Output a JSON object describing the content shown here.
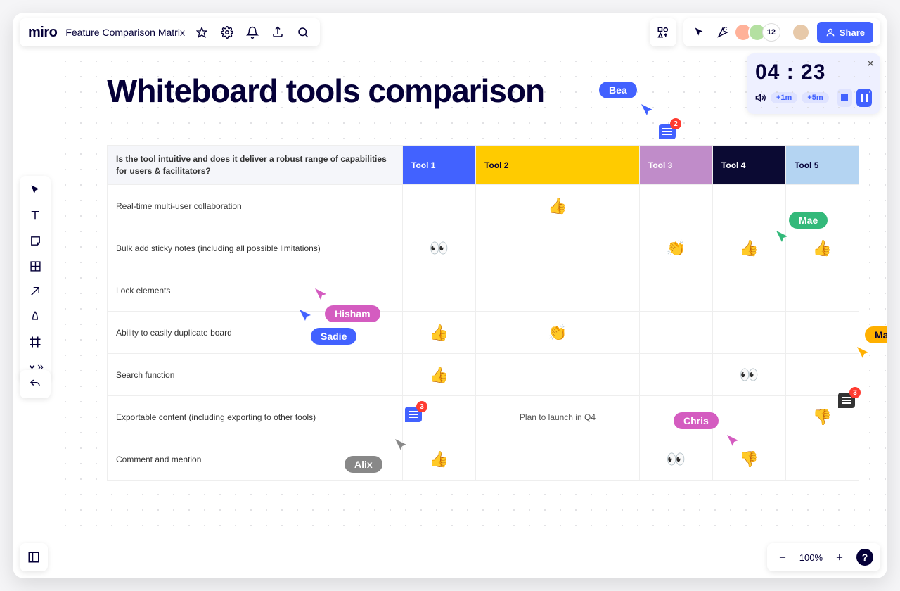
{
  "app": {
    "logo": "miro",
    "board_title": "Feature Comparison Matrix"
  },
  "collaborators": {
    "count_extra": "12"
  },
  "share_label": "Share",
  "timer": {
    "time": "04 : 23",
    "add1": "+1m",
    "add5": "+5m"
  },
  "canvas": {
    "title": "Whiteboard tools comparison",
    "question": "Is the tool intuitive and does it deliver a robust range of capabilities for users & facilitators?",
    "tools": [
      "Tool 1",
      "Tool 2",
      "Tool 3",
      "Tool 4",
      "Tool 5"
    ],
    "rows": [
      {
        "label": "Real-time multi-user collaboration",
        "cells": [
          "",
          "👍",
          "",
          "",
          ""
        ]
      },
      {
        "label": "Bulk add sticky notes (including all possible limitations)",
        "cells": [
          "👀",
          "",
          "👏",
          "👍",
          "👍"
        ]
      },
      {
        "label": "Lock elements",
        "cells": [
          "",
          "",
          "",
          "",
          ""
        ]
      },
      {
        "label": "Ability to easily duplicate board",
        "cells": [
          "👍",
          "👏",
          "",
          "",
          ""
        ]
      },
      {
        "label": "Search function",
        "cells": [
          "👍",
          "",
          "",
          "👀",
          ""
        ]
      },
      {
        "label": "Exportable content (including exporting to other tools)",
        "cells": [
          "",
          "Plan to launch in Q4",
          "",
          "",
          "👎"
        ]
      },
      {
        "label": "Comment and mention",
        "cells": [
          "👍",
          "",
          "👀",
          "👎",
          ""
        ]
      }
    ]
  },
  "cursors": {
    "bea": "Bea",
    "mae": "Mae",
    "hisham": "Hisham",
    "sadie": "Sadie",
    "matt": "Matt",
    "chris": "Chris",
    "alix": "Alix"
  },
  "comments": {
    "c1": "2",
    "c2": "3",
    "c3": "3"
  },
  "zoom": "100%"
}
